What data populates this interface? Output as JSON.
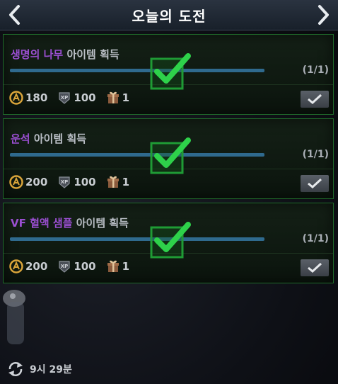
{
  "header": {
    "title": "오늘의 도전"
  },
  "missions": [
    {
      "highlight": "생명의 나무",
      "rest": " 아이템 획득",
      "progress": "(1/1)",
      "rewards": {
        "coins": "180",
        "xp": "100",
        "gift": "1"
      }
    },
    {
      "highlight": "운석",
      "rest": " 아이템 획득",
      "progress": "(1/1)",
      "rewards": {
        "coins": "200",
        "xp": "100",
        "gift": "1"
      }
    },
    {
      "highlight": "VF 혈액 샘플",
      "rest": " 아이템 획득",
      "progress": "(1/1)",
      "rewards": {
        "coins": "200",
        "xp": "100",
        "gift": "1"
      }
    }
  ],
  "footer": {
    "timer": "9시 29분"
  },
  "colors": {
    "accent_green": "#2ed14a",
    "highlight_purple": "#9a4fd1",
    "bar_blue": "#2f6a8e"
  },
  "icons": [
    "chevron-left-icon",
    "chevron-right-icon",
    "coin-icon",
    "xp-icon",
    "gift-icon",
    "checkmark-icon",
    "refresh-icon"
  ]
}
